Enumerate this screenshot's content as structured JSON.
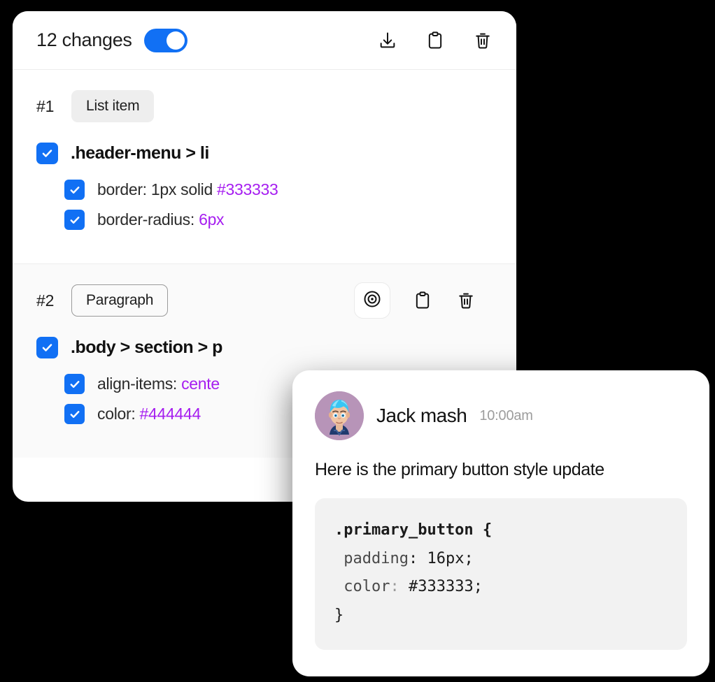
{
  "panel": {
    "title": "12 changes",
    "toggle": {
      "name": "changes-toggle",
      "state": "on"
    },
    "header_actions": [
      {
        "icon": "download-icon",
        "label": "Download"
      },
      {
        "icon": "clipboard-icon",
        "label": "Copy"
      },
      {
        "icon": "trash-icon",
        "label": "Delete"
      }
    ],
    "sections": [
      {
        "index": "#1",
        "chip": "List item",
        "chip_style": "filled",
        "selector": ".header-menu > li",
        "selector_checked": true,
        "actions": [],
        "properties": [
          {
            "checked": true,
            "name": "border: 1px solid ",
            "value": "#333333"
          },
          {
            "checked": true,
            "name": "border-radius: ",
            "value": "6px"
          }
        ]
      },
      {
        "index": "#2",
        "chip": "Paragraph",
        "chip_style": "outlined",
        "selector": ".body > section > p",
        "selector_checked": true,
        "actions": [
          {
            "icon": "target-icon",
            "label": "Inspect"
          },
          {
            "icon": "clipboard-icon",
            "label": "Copy"
          },
          {
            "icon": "trash-icon",
            "label": "Delete"
          }
        ],
        "properties": [
          {
            "checked": true,
            "name": "align-items: ",
            "value": "cente"
          },
          {
            "checked": true,
            "name": "color: ",
            "value": "#444444"
          }
        ]
      }
    ]
  },
  "comment": {
    "avatar_icon": "user-avatar",
    "author": "Jack mash",
    "timestamp": "10:00am",
    "message": "Here is the primary button style update",
    "code": {
      "line1": ".primary_button {",
      "line2_prop": " padding",
      "line2_rest": ": 16px;",
      "line3_prop": " color",
      "line3_colon": ":",
      "line3_rest": " #333333;",
      "line4": "}"
    }
  },
  "colors": {
    "accent_blue": "#1170f4",
    "value_purple": "#a61ef0",
    "page_background": "#000000",
    "chip_filled_bg": "#eeeeee",
    "code_bg": "#f2f2f2"
  }
}
